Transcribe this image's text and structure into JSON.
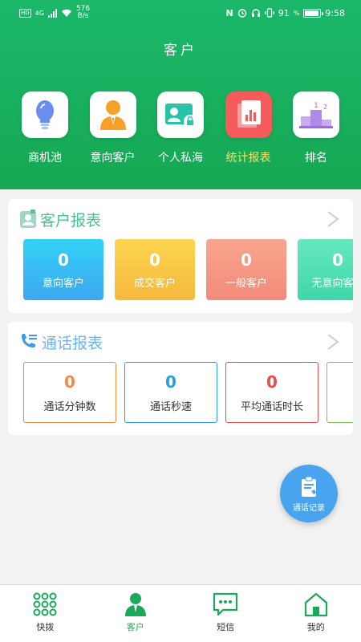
{
  "status_bar": {
    "hd": "HD",
    "network": "4G",
    "speed_value": "576",
    "speed_unit": "B/s",
    "nfc": "N",
    "battery": "91",
    "time": "9:58"
  },
  "header": {
    "title": "客户"
  },
  "quick_nav": [
    {
      "label": "商机池",
      "icon": "lightbulb-icon",
      "active": false
    },
    {
      "label": "意向客户",
      "icon": "business-person-icon",
      "active": false
    },
    {
      "label": "个人私海",
      "icon": "contact-card-lock-icon",
      "active": false
    },
    {
      "label": "统计报表",
      "icon": "report-chart-icon",
      "active": true
    },
    {
      "label": "排名",
      "icon": "podium-ranking-icon",
      "active": false
    }
  ],
  "customer_report": {
    "title": "客户报表",
    "stats": [
      {
        "value": "0",
        "label": "意向客户",
        "color": "#3ea8f0"
      },
      {
        "value": "0",
        "label": "成交客户",
        "color": "#f6b83a"
      },
      {
        "value": "0",
        "label": "一般客户",
        "color": "#f28a7a"
      },
      {
        "value": "0",
        "label": "无意向客户",
        "color": "#3fd6a8"
      }
    ]
  },
  "call_report": {
    "title": "通话报表",
    "stats": [
      {
        "value": "0",
        "label": "通话分钟数",
        "color": "#f08b46"
      },
      {
        "value": "0",
        "label": "通话秒速",
        "color": "#2a9fe0"
      },
      {
        "value": "0",
        "label": "平均通话时长",
        "color": "#e84c4c"
      },
      {
        "value": "",
        "label": "",
        "color": "#7cc35a"
      }
    ]
  },
  "fab": {
    "label": "通话记录",
    "icon": "clipboard-phone-icon"
  },
  "tabbar": [
    {
      "label": "快拨",
      "icon": "dialpad-icon",
      "active": false
    },
    {
      "label": "客户",
      "icon": "customer-person-icon",
      "active": true
    },
    {
      "label": "短信",
      "icon": "message-bubble-icon",
      "active": false
    },
    {
      "label": "我的",
      "icon": "home-icon",
      "active": false
    }
  ],
  "colors": {
    "brand": "#1aa85a",
    "active_nav_text": "#f3e266"
  }
}
